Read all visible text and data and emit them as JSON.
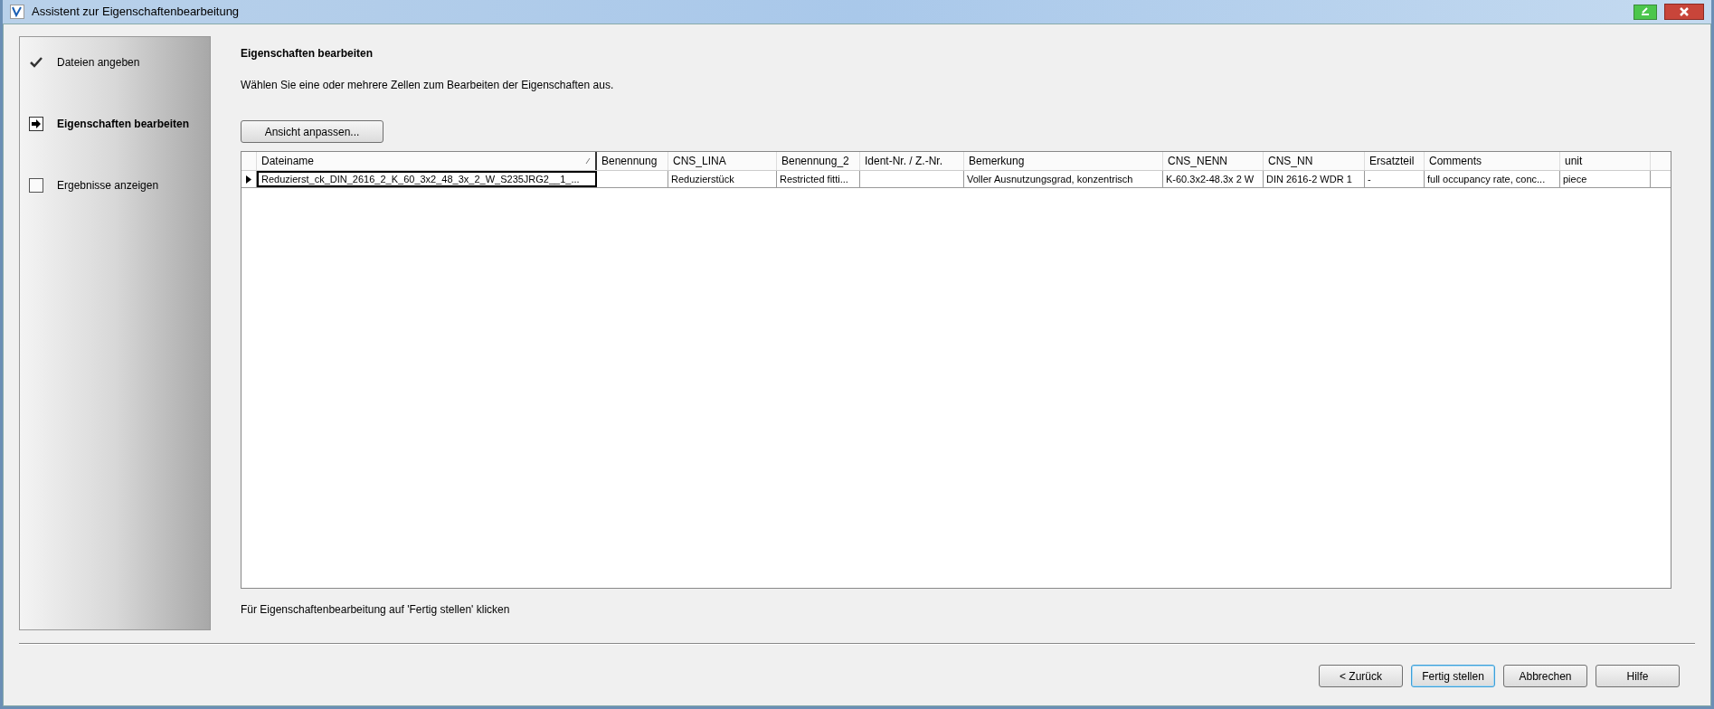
{
  "window": {
    "title": "Assistent zur Eigenschaftenbearbeitung"
  },
  "steps": [
    {
      "label": "Dateien angeben",
      "kind": "done"
    },
    {
      "label": "Eigenschaften bearbeiten",
      "kind": "current"
    },
    {
      "label": "Ergebnisse anzeigen",
      "kind": "pending"
    }
  ],
  "page": {
    "heading": "Eigenschaften bearbeiten",
    "instruction": "Wählen Sie eine oder mehrere Zellen zum Bearbeiten der Eigenschaften aus.",
    "view_button": "Ansicht anpassen...",
    "footer_hint": "Für Eigenschaftenbearbeitung auf 'Fertig stellen' klicken"
  },
  "table": {
    "columns": [
      "Dateiname",
      "Benennung",
      "CNS_LINA",
      "Benennung_2",
      "Ident-Nr. / Z.-Nr.",
      "Bemerkung",
      "CNS_NENN",
      "CNS_NN",
      "Ersatzteil",
      "Comments",
      "unit"
    ],
    "rows": [
      {
        "selected": true,
        "cells": [
          "Reduzierst_ck_DIN_2616_2_K_60_3x2_48_3x_2_W_S235JRG2__1_...",
          "",
          "Reduzierstück",
          "Restricted fitti...",
          "",
          "Voller Ausnutzungsgrad, konzentrisch",
          "K-60.3x2-48.3x 2 W",
          "DIN 2616-2 WDR 1",
          "-",
          "full occupancy rate, conc...",
          "piece"
        ]
      }
    ]
  },
  "buttons": [
    {
      "label": "< Zurück",
      "default": false
    },
    {
      "label": "Fertig stellen",
      "default": true
    },
    {
      "label": "Abbrechen",
      "default": false
    },
    {
      "label": "Hilfe",
      "default": false
    }
  ]
}
